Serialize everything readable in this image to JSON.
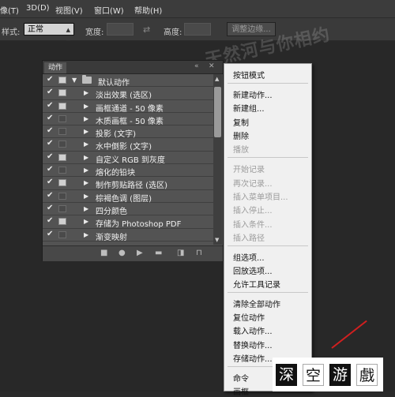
{
  "menubar": [
    "像(T)",
    "3D(D)",
    "视图(V)",
    "窗口(W)",
    "帮助(H)"
  ],
  "options": {
    "style_label": "样式:",
    "style_value": "正常",
    "width_label": "宽度:",
    "height_label": "高度:",
    "adjust_button": "调整边缘..."
  },
  "watermark": "天然河与你相约",
  "panel": {
    "tab": "动作",
    "rows": [
      {
        "label": "默认动作",
        "checked": true,
        "dialog": true,
        "level": 0
      },
      {
        "label": "淡出效果 (选区)",
        "checked": true,
        "dialog": true,
        "level": 1
      },
      {
        "label": "画框通道 - 50 像素",
        "checked": true,
        "dialog": true,
        "level": 1
      },
      {
        "label": "木质画框 - 50 像素",
        "checked": true,
        "dialog": false,
        "level": 1
      },
      {
        "label": "投影 (文字)",
        "checked": true,
        "dialog": false,
        "level": 1
      },
      {
        "label": "水中倒影 (文字)",
        "checked": true,
        "dialog": false,
        "level": 1
      },
      {
        "label": "自定义 RGB 到灰度",
        "checked": true,
        "dialog": true,
        "level": 1
      },
      {
        "label": "熔化的铅块",
        "checked": true,
        "dialog": false,
        "level": 1
      },
      {
        "label": "制作剪贴路径 (选区)",
        "checked": true,
        "dialog": true,
        "level": 1
      },
      {
        "label": "棕褐色调 (图层)",
        "checked": true,
        "dialog": false,
        "level": 1
      },
      {
        "label": "四分颜色",
        "checked": true,
        "dialog": false,
        "level": 1
      },
      {
        "label": "存储为 Photoshop PDF",
        "checked": true,
        "dialog": true,
        "level": 1
      },
      {
        "label": "渐变映射",
        "checked": true,
        "dialog": false,
        "level": 1
      }
    ]
  },
  "menu": {
    "items": [
      {
        "label": "按钮模式",
        "enabled": true
      },
      {
        "label": "新建动作...",
        "enabled": true
      },
      {
        "label": "新建组...",
        "enabled": true
      },
      {
        "label": "复制",
        "enabled": true
      },
      {
        "label": "删除",
        "enabled": true
      },
      {
        "label": "播放",
        "enabled": false
      },
      {
        "label": "开始记录",
        "enabled": false
      },
      {
        "label": "再次记录...",
        "enabled": false
      },
      {
        "label": "插入菜单项目...",
        "enabled": false
      },
      {
        "label": "插入停止...",
        "enabled": false
      },
      {
        "label": "插入条件...",
        "enabled": false
      },
      {
        "label": "插入路径",
        "enabled": false
      },
      {
        "label": "组选项...",
        "enabled": true
      },
      {
        "label": "回放选项...",
        "enabled": true
      },
      {
        "label": "允许工具记录",
        "enabled": true
      },
      {
        "label": "清除全部动作",
        "enabled": true
      },
      {
        "label": "复位动作",
        "enabled": true
      },
      {
        "label": "载入动作...",
        "enabled": true
      },
      {
        "label": "替换动作...",
        "enabled": true
      },
      {
        "label": "存储动作...",
        "enabled": true
      },
      {
        "label": "命令",
        "enabled": true
      },
      {
        "label": "画框",
        "enabled": true
      }
    ]
  },
  "logo_chars": [
    "深",
    "空",
    "游",
    "戲"
  ]
}
